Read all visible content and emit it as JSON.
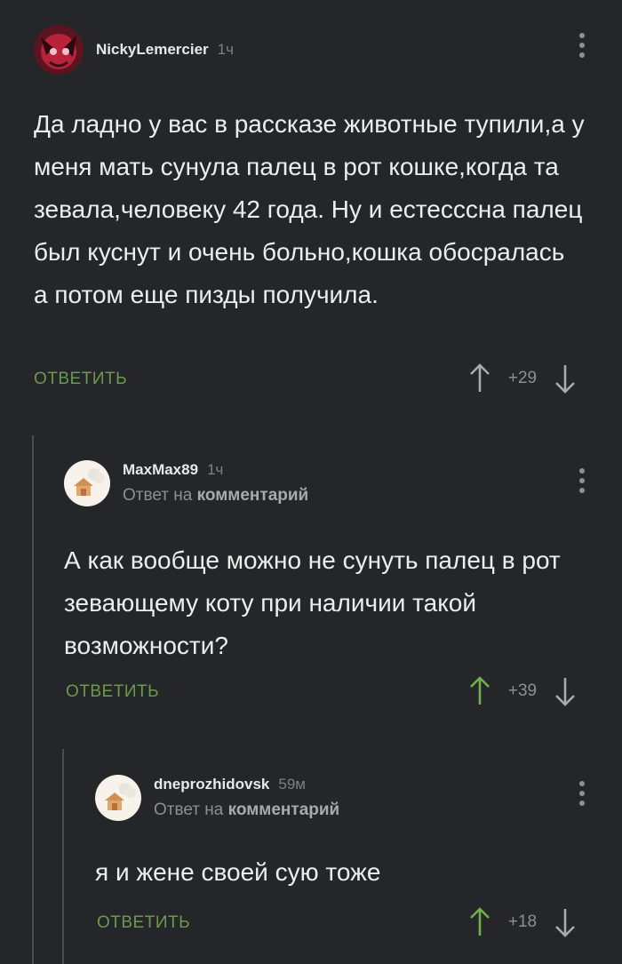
{
  "comments": [
    {
      "author": "NickyLemercier",
      "time": "1ч",
      "text": "Да ладно у вас в рассказе животные тупили,а у меня мать сунула палец в рот кошке,когда та зевала,человеку 42 года. Ну и естесссна палец был куснут и очень больно,кошка обосралась а потом еще пизды получила.",
      "reply_label": "ОТВЕТИТЬ",
      "score": "+29"
    },
    {
      "author": "MaxMax89",
      "time": "1ч",
      "reply_to_prefix": "Ответ на",
      "reply_to_target": "комментарий",
      "text": "А как вообще можно не сунуть палец в рот зевающему коту при наличии такой возможности?",
      "reply_label": "ОТВЕТИТЬ",
      "score": "+39"
    },
    {
      "author": "dneprozhidovsk",
      "time": "59м",
      "reply_to_prefix": "Ответ на",
      "reply_to_target": "комментарий",
      "text": "я и жене своей сую тоже",
      "reply_label": "ОТВЕТИТЬ",
      "score": "+18"
    }
  ],
  "colors": {
    "background": "#24262a",
    "reply_green": "#6a9a4c",
    "upvote_active": "#6fb04a",
    "muted": "#8c8f94"
  },
  "icons": {
    "menu": "more-vertical-icon",
    "upvote": "arrow-up-icon",
    "downvote": "arrow-down-icon"
  }
}
